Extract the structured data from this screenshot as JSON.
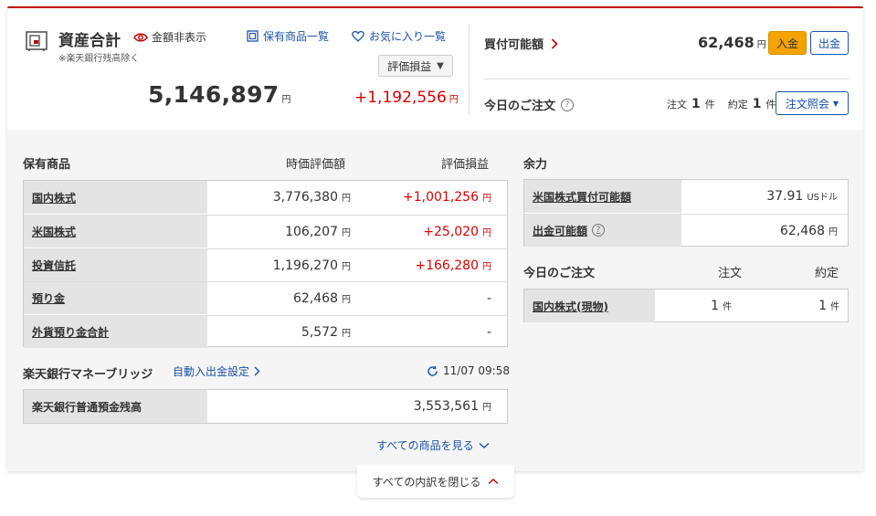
{
  "summary": {
    "title": "資産合計",
    "hide_amount_label": "金額非表示",
    "note": "※楽天銀行残高除く",
    "holdings_link": "保有商品一覧",
    "favorites_link": "お気に入り一覧",
    "select_value": "評価損益",
    "total_value": "5,146,897",
    "total_pl": "+1,192,556",
    "yen": "円"
  },
  "buying_power": {
    "label": "買付可能額",
    "value": "62,468",
    "yen": "円",
    "deposit_button": "入金",
    "withdraw_button": "出金"
  },
  "today_orders_top": {
    "label": "今日のご注文",
    "order_label": "注文",
    "order_count": "1",
    "fill_label": "約定",
    "fill_count": "1",
    "unit": "件",
    "inquiry_button": "注文照会"
  },
  "holdings": {
    "heading": "保有商品",
    "col_value": "時価評価額",
    "col_pl": "評価損益",
    "rows": [
      {
        "label": "国内株式",
        "value": "3,776,380",
        "pl": "+1,001,256",
        "pl_yen": "円"
      },
      {
        "label": "米国株式",
        "value": "106,207",
        "pl": "+25,020",
        "pl_yen": "円"
      },
      {
        "label": "投資信託",
        "value": "1,196,270",
        "pl": "+166,280",
        "pl_yen": "円"
      },
      {
        "label": "預り金",
        "value": "62,468",
        "pl": "-",
        "pl_yen": ""
      },
      {
        "label": "外貨預り金合計",
        "value": "5,572",
        "pl": "-",
        "pl_yen": ""
      }
    ],
    "yen": "円"
  },
  "money_bridge": {
    "title": "楽天銀行マネーブリッジ",
    "auto_link": "自動入出金設定",
    "timestamp": "11/07 09:58",
    "row_label": "楽天銀行普通預金残高",
    "row_value": "3,553,561",
    "yen": "円"
  },
  "see_all": "すべての商品を見る",
  "collapse": "すべての内訳を閉じる",
  "surplus": {
    "heading": "余力",
    "rows": [
      {
        "label": "米国株式買付可能額",
        "value": "37.91",
        "unit": "USドル"
      },
      {
        "label": "出金可能額",
        "value": "62,468",
        "unit": "円"
      }
    ]
  },
  "today_orders": {
    "heading": "今日のご注文",
    "col_order": "注文",
    "col_fill": "約定",
    "row_label": "国内株式(現物)",
    "order_count": "1",
    "fill_count": "1",
    "unit": "件"
  },
  "colors": {
    "brand_red": "#bf0000",
    "positive_red": "#d90000",
    "link_blue": "#1a53a8",
    "deposit_orange": "#f5a300"
  }
}
